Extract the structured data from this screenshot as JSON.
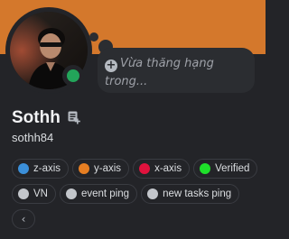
{
  "profile": {
    "display_name": "Sothh",
    "username": "sothh84",
    "status_color": "#23a55a",
    "banner_color": "#d4782c",
    "custom_status": {
      "icon": "plus-icon",
      "placeholder": "Vừa thăng hạng trong..."
    },
    "note_icon": "note-icon"
  },
  "roles": [
    {
      "name": "z-axis",
      "color": "#3b8fd9"
    },
    {
      "name": "y-axis",
      "color": "#e67e22"
    },
    {
      "name": "x-axis",
      "color": "#e0123d"
    },
    {
      "name": "Verified",
      "color": "#1ee02a"
    },
    {
      "name": "VN",
      "color": "#c3c6cb"
    },
    {
      "name": "event ping",
      "color": "#c3c6cb"
    },
    {
      "name": "new tasks ping",
      "color": "#c3c6cb"
    }
  ],
  "collapse": {
    "icon": "chevron-left-icon",
    "glyph": "‹"
  }
}
